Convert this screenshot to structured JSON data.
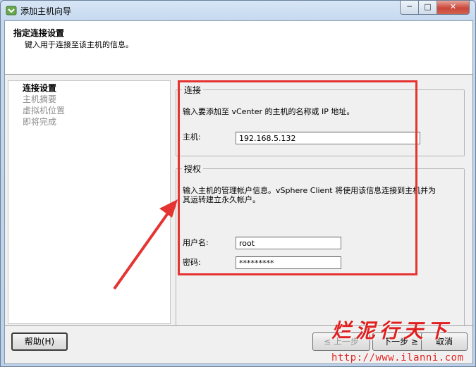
{
  "window": {
    "title": "添加主机向导",
    "min_glyph": "─",
    "max_glyph": "□",
    "close_glyph": "✕"
  },
  "header": {
    "title": "指定连接设置",
    "subtitle": "键入用于连接至该主机的信息。"
  },
  "steps": [
    {
      "label": "连接设置",
      "active": true
    },
    {
      "label": "主机摘要",
      "active": false
    },
    {
      "label": "虚拟机位置",
      "active": false
    },
    {
      "label": "即将完成",
      "active": false
    }
  ],
  "connection": {
    "legend": "连接",
    "description": "输入要添加至 vCenter 的主机的名称或 IP 地址。",
    "host_label": "主机:",
    "host_value": "192.168.5.132"
  },
  "auth": {
    "legend": "授权",
    "description_line1": "输入主机的管理帐户信息。vSphere Client 将使用该信息连接到主机并为",
    "description_line2": "其运转建立永久帐户。",
    "username_label": "用户名:",
    "username_value": "root",
    "password_label": "密码:",
    "password_value": "*********"
  },
  "buttons": {
    "help": "帮助(H)",
    "back": "≤ 上一步",
    "next": "下一步 ≥",
    "cancel": "取消"
  },
  "watermark": {
    "brand": "烂泥行天下",
    "url": "http://www.ilanni.com"
  },
  "colors": {
    "annotation": "#e53332",
    "watermark": "#e02020"
  }
}
